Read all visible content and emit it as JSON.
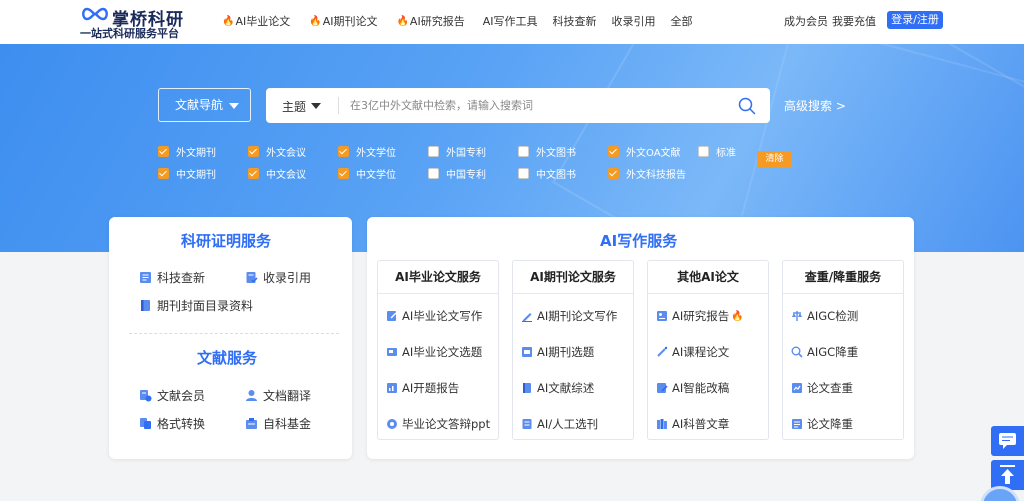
{
  "header": {
    "logo_title": "掌桥科研",
    "logo_subtitle": "一站式科研服务平台",
    "nav": [
      {
        "label": "AI毕业论文",
        "hot": true
      },
      {
        "label": "AI期刊论文",
        "hot": true
      },
      {
        "label": "AI研究报告",
        "hot": true
      },
      {
        "label": "AI写作工具",
        "hot": false
      },
      {
        "label": "科技查新",
        "hot": false
      },
      {
        "label": "收录引用",
        "hot": false
      },
      {
        "label": "全部",
        "hot": false
      }
    ],
    "member": "成为会员",
    "recharge": "我要充值",
    "login": "登录/注册"
  },
  "search": {
    "nav_label": "文献导航",
    "topic_label": "主题",
    "placeholder": "在3亿中外文献中检索，请输入搜索词",
    "advanced": "高级搜索 >",
    "clear": "清除",
    "row1": [
      {
        "label": "外文期刊",
        "checked": true
      },
      {
        "label": "外文会议",
        "checked": true
      },
      {
        "label": "外文学位",
        "checked": true
      },
      {
        "label": "外国专利",
        "checked": false
      },
      {
        "label": "外文图书",
        "checked": false
      },
      {
        "label": "外文OA文献",
        "checked": true
      },
      {
        "label": "标准",
        "checked": false
      }
    ],
    "row2": [
      {
        "label": "中文期刊",
        "checked": true
      },
      {
        "label": "中文会议",
        "checked": true
      },
      {
        "label": "中文学位",
        "checked": true
      },
      {
        "label": "中国专利",
        "checked": false
      },
      {
        "label": "中文图书",
        "checked": false
      },
      {
        "label": "外文科技报告",
        "checked": true
      }
    ]
  },
  "research_services": {
    "title": "科研证明服务",
    "items": [
      "科技查新",
      "收录引用",
      "期刊封面目录资料"
    ]
  },
  "doc_services": {
    "title": "文献服务",
    "items": [
      "文献会员",
      "文档翻译",
      "格式转换",
      "自科基金"
    ]
  },
  "ai_services": {
    "title": "AI写作服务",
    "columns": [
      {
        "title": "AI毕业论文服务",
        "items": [
          "AI毕业论文写作",
          "AI毕业论文选题",
          "AI开题报告",
          "毕业论文答辩ppt"
        ]
      },
      {
        "title": "AI期刊论文服务",
        "items": [
          "AI期刊论文写作",
          "AI期刊选题",
          "AI文献综述",
          "AI/人工选刊"
        ]
      },
      {
        "title": "其他AI论文",
        "items": [
          "AI研究报告",
          "AI课程论文",
          "AI智能改稿",
          "AI科普文章"
        ]
      },
      {
        "title": "查重/降重服务",
        "items": [
          "AIGC检测",
          "AIGC降重",
          "论文查重",
          "论文降重"
        ]
      }
    ]
  },
  "colors": {
    "primary": "#2f6ef5",
    "check": "#f59a23",
    "hot": "#f26b1d"
  }
}
